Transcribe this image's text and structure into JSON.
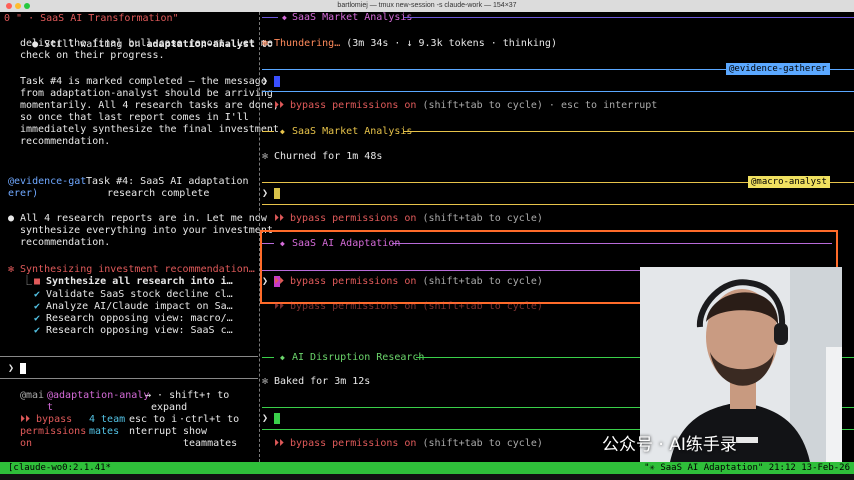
{
  "window": {
    "title": "bartlomiej — tmux new-session -s claude-work — 154×37"
  },
  "left": {
    "header": "0 \" · SaaS AI Transformation\"",
    "msg1_bullet": "●",
    "msg1_line1_a": "Still waiting on ",
    "msg1_line1_b": "adaptation-analyst",
    "msg1_line1_c": " to",
    "msg1_line2": "deliver the final bull-case report. Let me",
    "msg1_line3": "check on their progress.",
    "msg2_line1": "Task #4 is marked completed — the message",
    "msg2_line2": "from adaptation-analyst should be arriving",
    "msg2_line3": "momentarily. All 4 research tasks are done,",
    "msg2_line4": "so once that last report comes in I'll",
    "msg2_line5": "immediately synthesize the final investment",
    "msg2_line6": "recommendation.",
    "note_name_1": "@evidence-gat",
    "note_name_2": "erer)",
    "note_text_1": "Task #4: SaaS AI adaptation",
    "note_text_2": "research complete",
    "msg3_line1": "All 4 research reports are in. Let me now",
    "msg3_line2": "synthesize everything into your investment",
    "msg3_line3": "recommendation.",
    "synth": "Synthesizing investment recommendation…",
    "tasks": [
      {
        "mark": "■",
        "text": "Synthesize all research into i…"
      },
      {
        "mark": "✔",
        "text": "Validate SaaS stock decline cl…"
      },
      {
        "mark": "✔",
        "text": "Analyze AI/Claude impact on Sa…"
      },
      {
        "mark": "✔",
        "text": "Research opposing view: macro/…"
      },
      {
        "mark": "✔",
        "text": "Research opposing view: SaaS c…"
      }
    ],
    "prompt": "❯",
    "footer": {
      "row1_a": "@mai",
      "row1_b": "@adaptation-analy",
      "row1_c": "→ · shift+↑ to",
      "row2_b": "t",
      "row2_c": "expand",
      "row3_a": "⏵⏵ bypass",
      "row3_b": "4 team",
      "row3_c": "esc to i",
      "row3_d": "·ctrl+t to",
      "row4_a": "permissions",
      "row4_b": "mates",
      "row4_c": "nterrupt",
      "row4_d": "show",
      "row5_a": "on",
      "row5_d": "teammates"
    }
  },
  "right": {
    "p1_header": "SaaS Market Analysis",
    "p1_status_a": "Thundering…",
    "p1_status_b": " (3m 34s · ↓ 9.3k tokens · thinking)",
    "p1_tag": "@evidence-gatherer",
    "p1_bypass_a": "⏵⏵ bypass permissions on",
    "p1_bypass_b": " (shift+tab to cycle) · esc to interrupt",
    "p2_header": "SaaS Market Analysis",
    "p2_status": "Churned for 1m 48s",
    "p2_tag": "@macro-analyst",
    "p2_bypass_a": "⏵⏵ bypass permissions on",
    "p2_bypass_b": " (shift+tab to cycle)",
    "p3_header": "SaaS AI Adaptation",
    "p3_bypass_a": "⏵⏵ bypass permissions on",
    "p3_bypass_b": " (shift+tab to cycle)",
    "p3_ghost": "⏵⏵ bypass permissions on (shift+tab to cycle)",
    "p4_header": "AI Disruption Research",
    "p4_status": "Baked for 3m 12s",
    "p4_bypass_a": "⏵⏵ bypass permissions on",
    "p4_bypass_b": " (shift+tab to cycle)",
    "prompt": "❯",
    "spark": "✻",
    "diamond": "◆"
  },
  "statusbar": {
    "left": "[claude-wo0:2.1.41*",
    "right": "\"✳ SaaS AI Adaptation\" 21:12 13-Feb-26"
  },
  "watermark": "公众号 · AI练手录",
  "colors": {
    "status_green": "#2fbf3a",
    "tag_blue": "#5ba8ff",
    "tag_yellow": "#f0e060",
    "tag_magenta": "#b86ad9",
    "focus_orange": "#ff6b2a",
    "prompt_blue": "#3a4fff",
    "prompt_yellow": "#d8c24a",
    "prompt_magenta": "#c53ac9",
    "prompt_green": "#3ad04a"
  }
}
